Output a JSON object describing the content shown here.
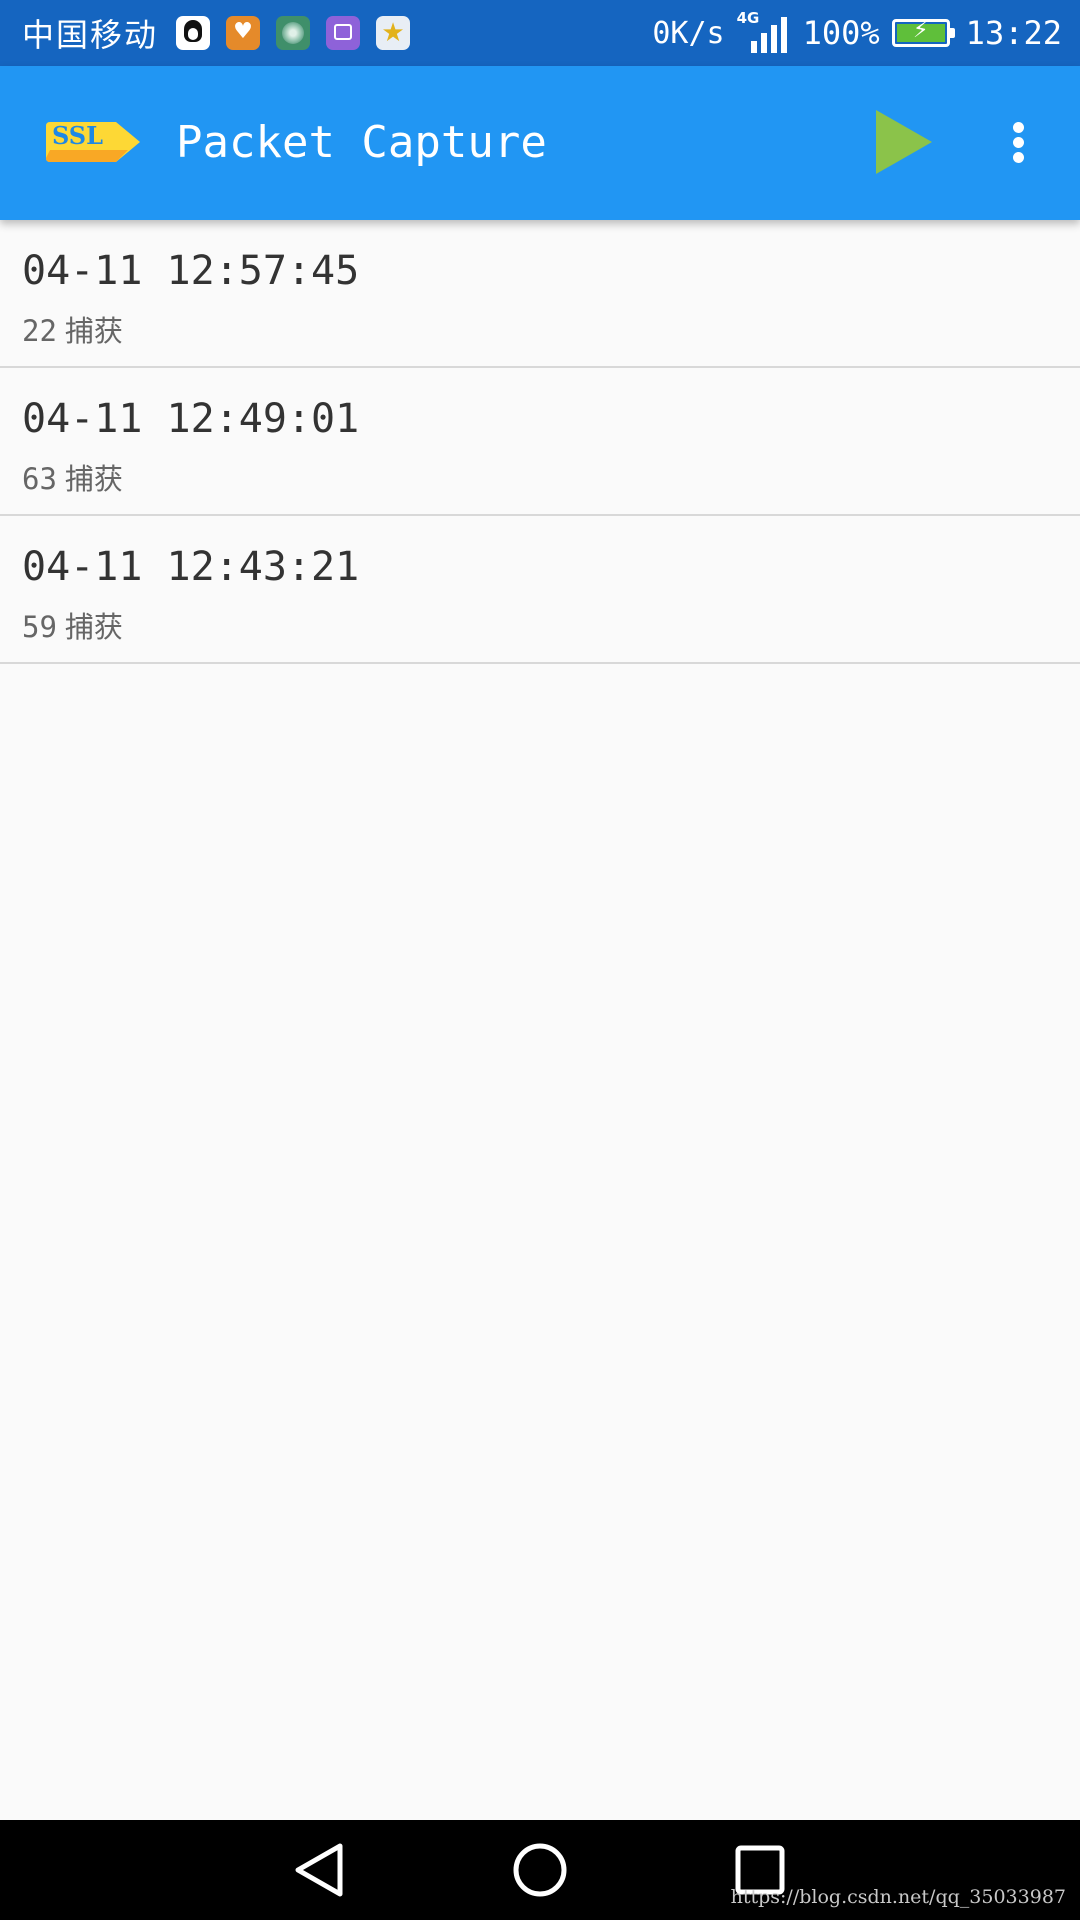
{
  "status_bar": {
    "carrier": "中国移动",
    "notification_icons": [
      "qq-icon",
      "health-icon",
      "music-icon",
      "gallery-icon",
      "star-icon"
    ],
    "net_speed": "0K/s",
    "network_type": "4G",
    "battery": "100%",
    "battery_level": 1.0,
    "time": "13:22"
  },
  "app_bar": {
    "title": "Packet Capture",
    "logo_text": "SSL",
    "actions": [
      "play-icon",
      "more-vert-icon"
    ]
  },
  "sessions": [
    {
      "time": "04-11 12:57:45",
      "count": "22",
      "count_label": "捕获"
    },
    {
      "time": "04-11 12:49:01",
      "count": "63",
      "count_label": "捕获"
    },
    {
      "time": "04-11 12:43:21",
      "count": "59",
      "count_label": "捕获"
    }
  ],
  "nav_bar": {
    "buttons": [
      "back-icon",
      "home-icon",
      "recents-icon"
    ]
  },
  "watermark": "https://blog.csdn.net/qq_35033987",
  "colors": {
    "status_bar": "#1565c0",
    "app_bar": "#2196f3",
    "play_icon": "#8bc34a",
    "background": "#fafafa",
    "logo": "#fdd835"
  }
}
